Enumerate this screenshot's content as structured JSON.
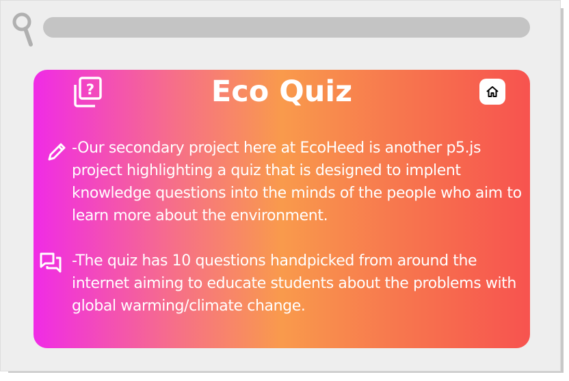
{
  "search": {
    "placeholder": ""
  },
  "card": {
    "title": "Eco Quiz",
    "paragraphs": [
      "-Our secondary project here at EcoHeed is another p5.js project highlighting a quiz that is designed to implent knowledge questions into the minds of the people who aim to learn more about the environment.",
      "-The quiz has 10 questions handpicked from around the internet aiming to educate students about the problems with global warming/climate change."
    ]
  },
  "icons": {
    "search": "search-icon",
    "quiz": "quiz-icon",
    "home": "home-icon",
    "pencil": "pencil-icon",
    "chat": "chat-icon"
  },
  "colors": {
    "gradient_start": "#f02be6",
    "gradient_mid": "#f99a4c",
    "gradient_end": "#f7534f",
    "text": "#ffffff"
  }
}
